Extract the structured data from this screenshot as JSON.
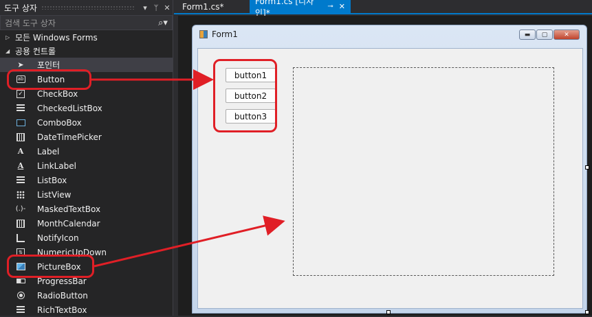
{
  "toolbox": {
    "title": "도구 상자",
    "pin": "ᛘ",
    "close": "✕",
    "dropdown": "▾",
    "search_placeholder": "검색 도구 상자",
    "search_icon": "search-icon",
    "groups": [
      {
        "label": "모든 Windows Forms",
        "expanded": false
      },
      {
        "label": "공용 컨트롤",
        "expanded": true
      }
    ],
    "items": [
      {
        "label": "포인터",
        "icon": "pointer-icon"
      },
      {
        "label": "Button",
        "icon": "button-icon"
      },
      {
        "label": "CheckBox",
        "icon": "checkbox-icon"
      },
      {
        "label": "CheckedListBox",
        "icon": "checkedlistbox-icon"
      },
      {
        "label": "ComboBox",
        "icon": "combobox-icon"
      },
      {
        "label": "DateTimePicker",
        "icon": "datetimepicker-icon"
      },
      {
        "label": "Label",
        "icon": "label-icon"
      },
      {
        "label": "LinkLabel",
        "icon": "linklabel-icon"
      },
      {
        "label": "ListBox",
        "icon": "listbox-icon"
      },
      {
        "label": "ListView",
        "icon": "listview-icon"
      },
      {
        "label": "MaskedTextBox",
        "icon": "maskedtextbox-icon"
      },
      {
        "label": "MonthCalendar",
        "icon": "monthcalendar-icon"
      },
      {
        "label": "NotifyIcon",
        "icon": "notifyicon-icon"
      },
      {
        "label": "NumericUpDown",
        "icon": "numericupdown-icon"
      },
      {
        "label": "PictureBox",
        "icon": "picturebox-icon"
      },
      {
        "label": "ProgressBar",
        "icon": "progressbar-icon"
      },
      {
        "label": "RadioButton",
        "icon": "radiobutton-icon"
      },
      {
        "label": "RichTextBox",
        "icon": "richtextbox-icon"
      }
    ]
  },
  "tabs": [
    {
      "label": "Form1.cs*",
      "active": false
    },
    {
      "label": "Form1.cs [디자인]*",
      "active": true
    }
  ],
  "form": {
    "title": "Form1",
    "buttons": [
      "button1",
      "button2",
      "button3"
    ],
    "minimize": "▬",
    "maximize": "▢",
    "close": "✕"
  },
  "colors": {
    "accent": "#007acc",
    "highlight": "#e01f26",
    "panel_bg": "#252526"
  }
}
